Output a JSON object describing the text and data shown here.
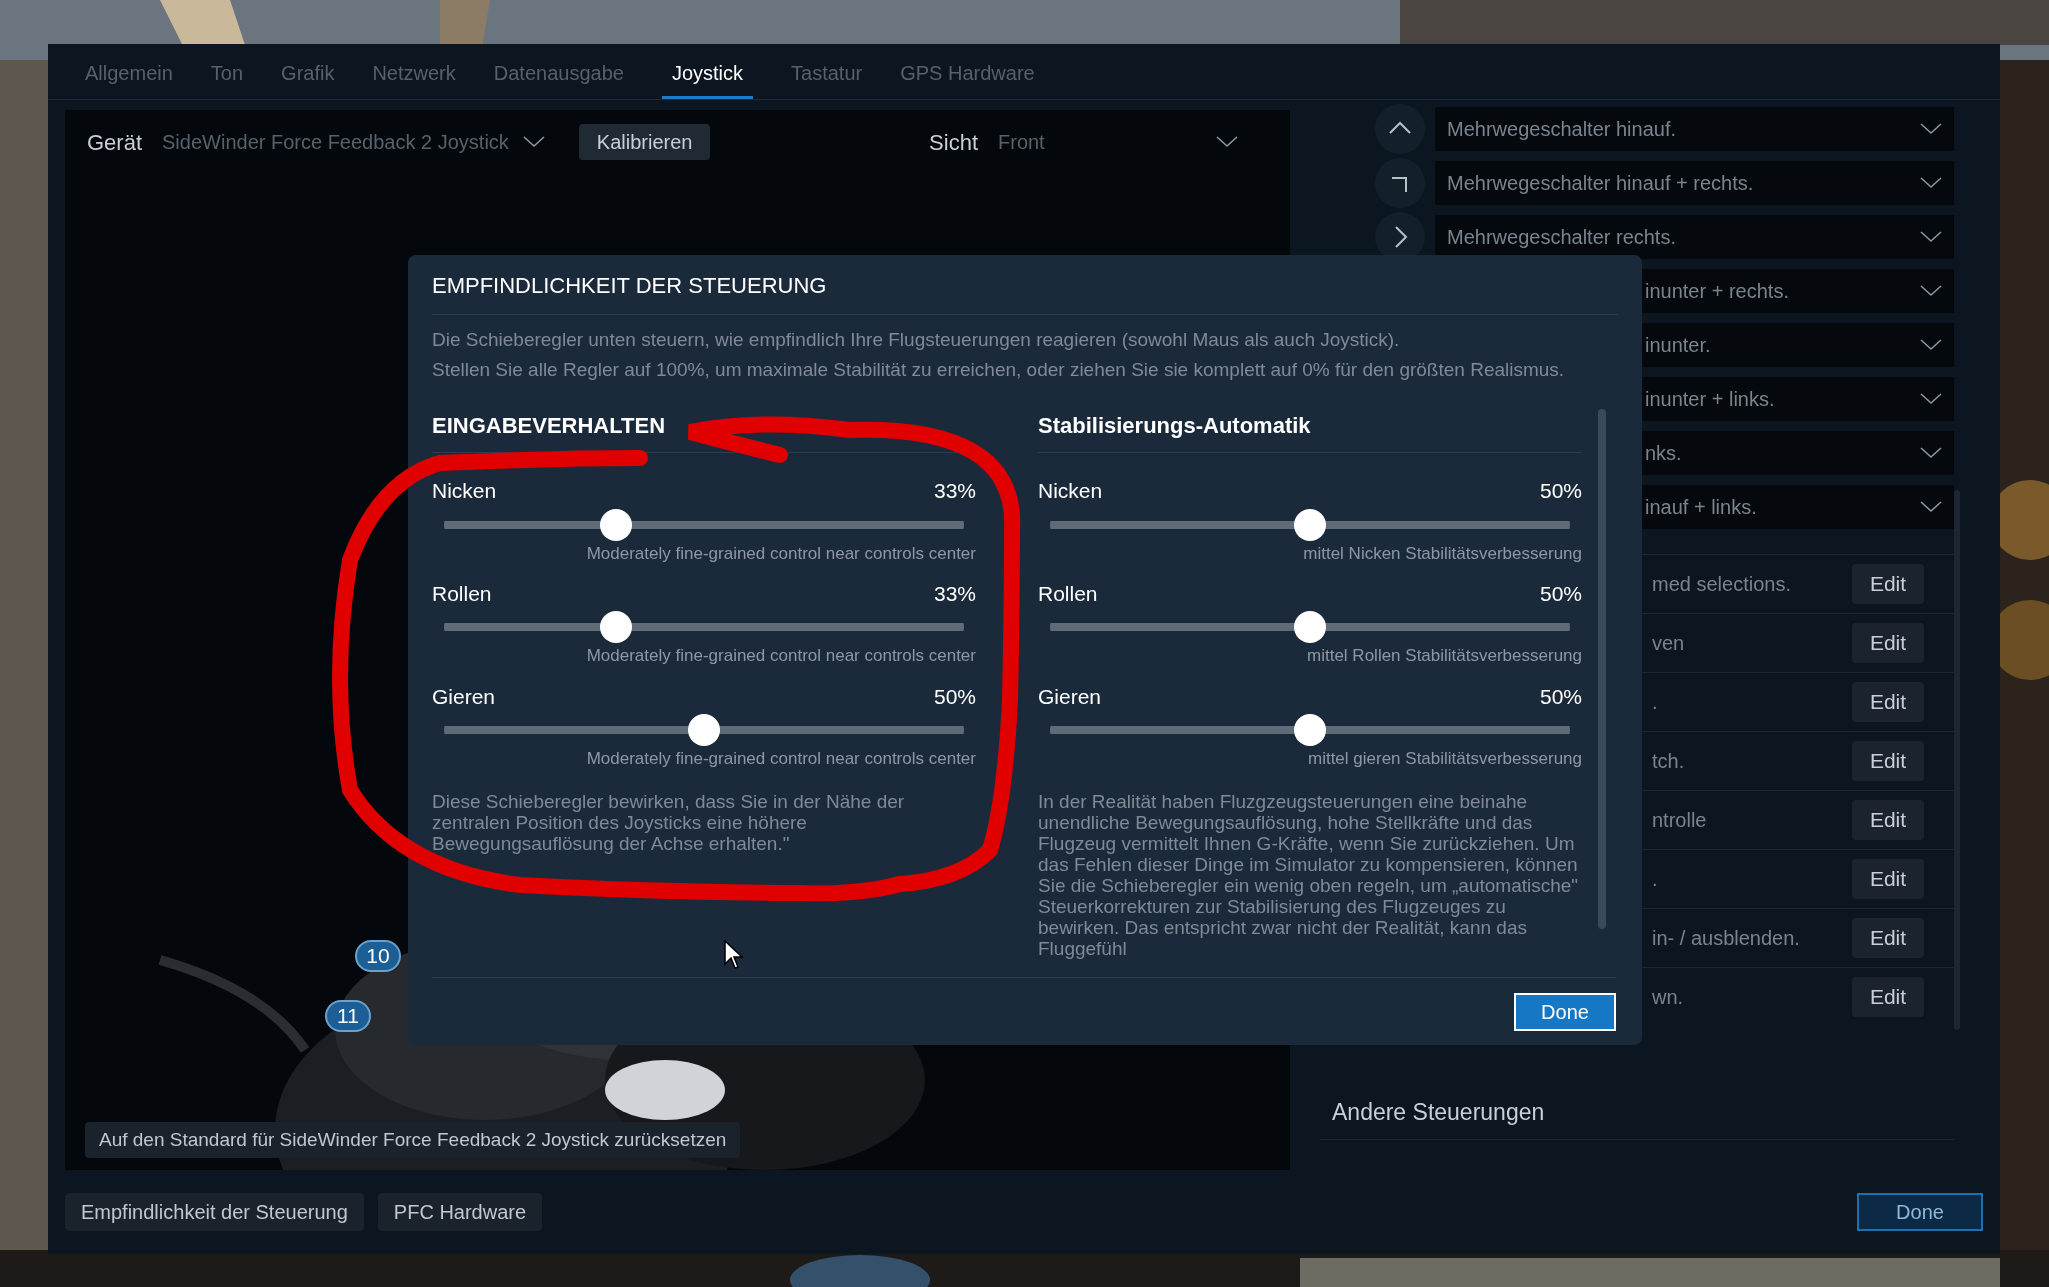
{
  "tabs": [
    {
      "label": "Allgemein",
      "selected": false
    },
    {
      "label": "Ton",
      "selected": false
    },
    {
      "label": "Grafik",
      "selected": false
    },
    {
      "label": "Netzwerk",
      "selected": false
    },
    {
      "label": "Datenausgabe",
      "selected": false
    },
    {
      "label": "Joystick",
      "selected": true
    },
    {
      "label": "Tastatur",
      "selected": false
    },
    {
      "label": "GPS Hardware",
      "selected": false
    }
  ],
  "device": {
    "label": "Gerät",
    "value": "SideWinder Force Feedback 2 Joystick",
    "calibrate": "Kalibrieren",
    "view_label": "Sicht",
    "view_value": "Front"
  },
  "joystick_badges": [
    "10",
    "11"
  ],
  "reset_button": "Auf den Standard für SideWinder Force Feedback 2 Joystick zurücksetzen",
  "hat_rows": [
    {
      "text": "Mehrwegeschalter hinauf."
    },
    {
      "text": "Mehrwegeschalter hinauf + rechts."
    },
    {
      "text": "Mehrwegeschalter rechts."
    },
    {
      "text": "inunter + rechts."
    },
    {
      "text": "inunter."
    },
    {
      "text": "inunter + links."
    },
    {
      "text": "nks."
    },
    {
      "text": "inauf + links."
    }
  ],
  "edit_rows": [
    {
      "text": "med selections.",
      "button": "Edit"
    },
    {
      "text": "ven",
      "button": "Edit"
    },
    {
      "text": ".",
      "button": "Edit"
    },
    {
      "text": "tch.",
      "button": "Edit"
    },
    {
      "text": "ntrolle",
      "button": "Edit"
    },
    {
      "text": ".",
      "button": "Edit"
    },
    {
      "text": "in- / ausblenden.",
      "button": "Edit"
    },
    {
      "text": "wn.",
      "button": "Edit"
    }
  ],
  "other_controls": "Andere Steuerungen",
  "bottom_buttons": [
    "Empfindlichkeit der Steuerung",
    "PFC Hardware"
  ],
  "done_button": "Done",
  "dialog": {
    "title": "EMPFINDLICHKEIT DER STEUERUNG",
    "intro": [
      "Die Schieberegler unten steuern, wie empfindlich Ihre Flugsteuerungen reagieren (sowohl Maus als auch Joystick).",
      "Stellen Sie alle Regler auf 100%, um maximale Stabilität zu erreichen, oder ziehen Sie sie komplett auf 0% für den größten Realismus."
    ],
    "columns": [
      {
        "heading": "EINGABEVERHALTEN",
        "sliders": [
          {
            "name": "Nicken",
            "reading": "33%",
            "level": 0.33,
            "caption": "Moderately fine-grained control near controls center"
          },
          {
            "name": "Rollen",
            "reading": "33%",
            "level": 0.33,
            "caption": "Moderately fine-grained control near controls center"
          },
          {
            "name": "Gieren",
            "reading": "50%",
            "level": 0.5,
            "caption": "Moderately fine-grained control near controls center"
          }
        ],
        "note": "Diese Schieberegler bewirken, dass Sie in der Nähe der zentralen Position des Joysticks eine höhere Bewegungsauflösung der Achse erhalten.\""
      },
      {
        "heading": "Stabilisierungs-Automatik",
        "sliders": [
          {
            "name": "Nicken",
            "reading": "50%",
            "level": 0.5,
            "caption": "mittel Nicken Stabilitätsverbesserung"
          },
          {
            "name": "Rollen",
            "reading": "50%",
            "level": 0.5,
            "caption": "mittel Rollen Stabilitätsverbesserung"
          },
          {
            "name": "Gieren",
            "reading": "50%",
            "level": 0.5,
            "caption": "mittel gieren Stabilitätsverbesserung"
          }
        ],
        "note": "In der Realität haben Fluzgzeugsteuerungen eine beinahe unendliche Bewegungsauflösung, hohe Stellkräfte und das Flugzeug vermittelt Ihnen G-Kräfte, wenn Sie zurückziehen. Um das Fehlen dieser Dinge im Simulator zu kompensieren, können Sie die Schieberegler ein wenig oben regeln, um „automatische\" Steuerkorrekturen zur Stabilisierung des Flugzeuges zu bewirken. Das entspricht zwar nicht der Realität, kann das Fluggefühl"
      }
    ],
    "done": "Done"
  }
}
